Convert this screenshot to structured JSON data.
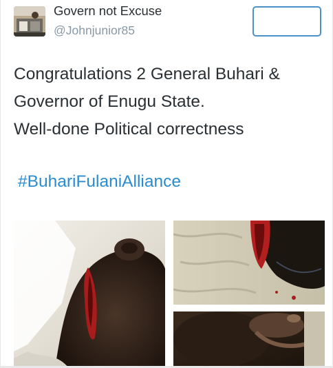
{
  "author": {
    "display_name": "Govern not Excuse",
    "handle": "@Johnjunior85"
  },
  "tweet": {
    "lines": [
      "Congratulations 2 General Buhari &",
      "Governor of Enugu State.",
      "Well-done Political correctness"
    ],
    "hashtag": "#BuhariFulaniAlliance"
  },
  "colors": {
    "hashtag": "#2a8ccf",
    "follow_border": "#4a90c9",
    "handle": "#8899a6",
    "text": "#292f33"
  },
  "media": {
    "count": 3,
    "icons": [
      "photo-1",
      "photo-2",
      "photo-3"
    ]
  }
}
